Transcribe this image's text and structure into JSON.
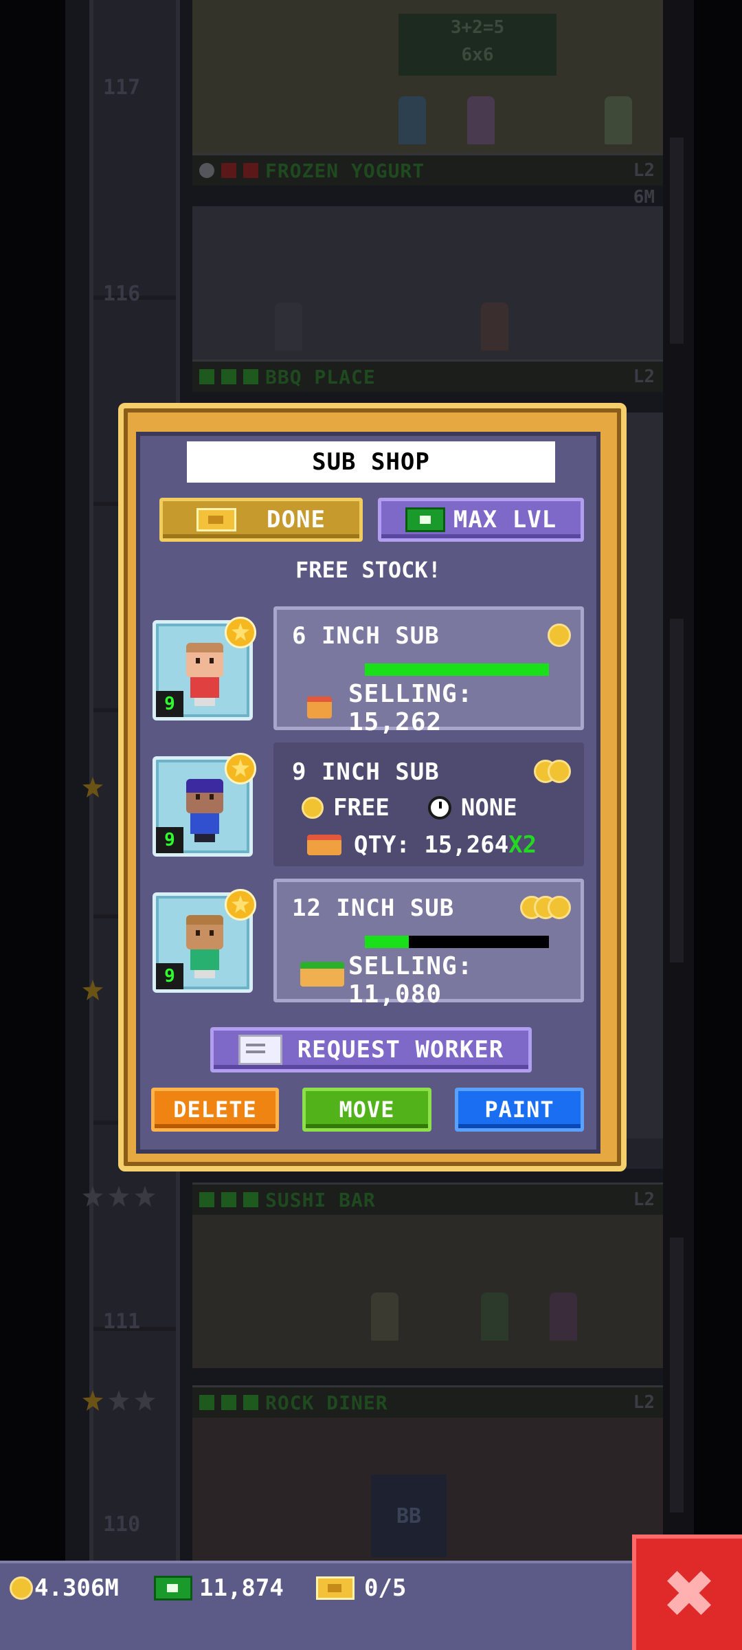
{
  "background": {
    "floors": [
      {
        "number": "117",
        "name": "",
        "level": "",
        "price": ""
      },
      {
        "number": "",
        "name": "FROZEN YOGURT",
        "level": "L2",
        "price": "6M"
      },
      {
        "number": "116",
        "name": "BBQ PLACE",
        "level": "L2",
        "price": ""
      },
      {
        "number": "111",
        "name": "SUSHI BAR",
        "level": "L2",
        "price": ""
      },
      {
        "number": "110",
        "name": "ROCK DINER",
        "level": "L2",
        "price": ""
      }
    ],
    "chalkboard": "3+2=5\n6x6",
    "sign": "BB"
  },
  "modal": {
    "name_value": "SUB SHOP",
    "done_label": "DONE",
    "max_lvl_label": "MAX LVL",
    "free_stock_label": "FREE STOCK!",
    "workers": [
      {
        "level": "9",
        "hair": "#c58a5c",
        "skin": "#f0b896",
        "shirt": "#e04040"
      },
      {
        "level": "9",
        "hair": "#3b2aa0",
        "skin": "#a8725a",
        "shirt": "#3050d0"
      },
      {
        "level": "9",
        "hair": "#b07a40",
        "skin": "#c89060",
        "shirt": "#28b070"
      }
    ],
    "stock_items": [
      {
        "name": "6 INCH SUB",
        "coins": 1,
        "selling_label": "SELLING: 15,262",
        "progress": 1.0
      },
      {
        "name": "9 INCH SUB",
        "coins": 2,
        "cost_label": "FREE",
        "time_label": "NONE",
        "qty_label": "QTY: 15,264",
        "multiplier": "X2"
      },
      {
        "name": "12 INCH SUB",
        "coins": 3,
        "selling_label": "SELLING: 11,080",
        "progress": 0.24
      }
    ],
    "request_worker_label": "REQUEST WORKER",
    "delete_label": "DELETE",
    "move_label": "MOVE",
    "paint_label": "PAINT"
  },
  "bottom_bar": {
    "coins": "4.306M",
    "bux": "11,874",
    "tickets": "0/5"
  },
  "colors": {
    "modal_frame": "#e6a840",
    "modal_panel": "#5b5884",
    "progress_fill": "#19e019",
    "close_button": "#e02a2a"
  }
}
